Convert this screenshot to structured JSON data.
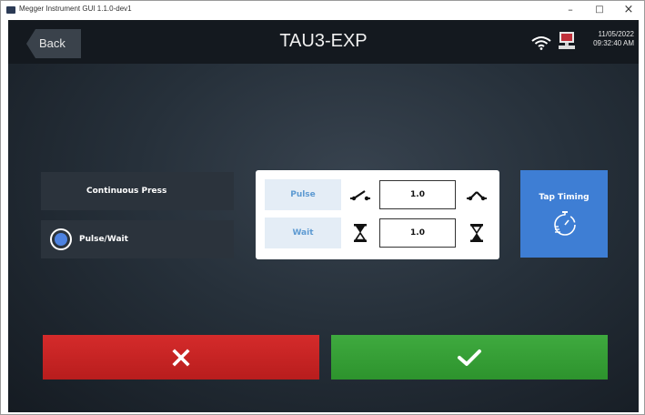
{
  "window": {
    "title": "Megger Instrument GUI 1.1.0-dev1",
    "minimize_symbol": "–",
    "maximize_symbol": "□",
    "close_symbol": "×"
  },
  "header": {
    "back_label": "Back",
    "title": "TAU3-EXP",
    "date": "11/05/2022",
    "time": "09:32:40 AM",
    "icons": [
      "wifi-icon",
      "computer-icon"
    ]
  },
  "modes": {
    "continuous_label": "Continuous Press",
    "pulse_wait_label": "Pulse/Wait",
    "selected": "Pulse/Wait"
  },
  "timing": {
    "pulse_label": "Pulse",
    "pulse_value": "1.0",
    "wait_label": "Wait",
    "wait_value": "1.0"
  },
  "tap_timing": {
    "label": "Tap Timing",
    "icon": "stopwatch-icon"
  },
  "actions": {
    "cancel_icon": "x-icon",
    "confirm_icon": "checkmark-icon"
  },
  "colors": {
    "accent_blue": "#3e7ed4",
    "cancel_red": "#c92424",
    "confirm_green": "#36a136",
    "topbar": "#14191f"
  }
}
